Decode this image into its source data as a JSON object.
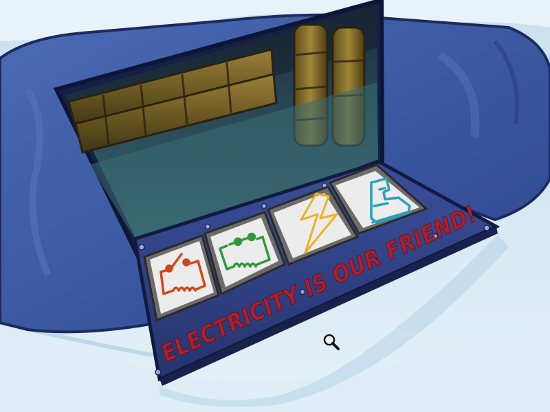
{
  "scene": {
    "banner_text": "ELECTRICITY IS OUR FRIEND!",
    "colors": {
      "snow": "#d7e9f3",
      "snow_shadow": "#9fc2dc",
      "machine_body": "#3f5fa8",
      "machine_dark": "#1f2e66",
      "panel": "#2f3f86",
      "plate_frame": "#7a7a7a",
      "plate_face": "#ececec",
      "cavity": "#2c4e58",
      "pipes": "#7a6a2a",
      "banner_red": "#b21d2a"
    },
    "buttons": [
      {
        "icon": "switch-circuit-icon",
        "color": "#d2471a"
      },
      {
        "icon": "coil-circuit-icon",
        "color": "#2f9a3a"
      },
      {
        "icon": "lightning-bolt-icon",
        "color": "#f0b020"
      },
      {
        "icon": "boot-icon",
        "color": "#2aa0b8"
      }
    ],
    "cursor": {
      "icon": "magnifying-glass-icon"
    }
  }
}
